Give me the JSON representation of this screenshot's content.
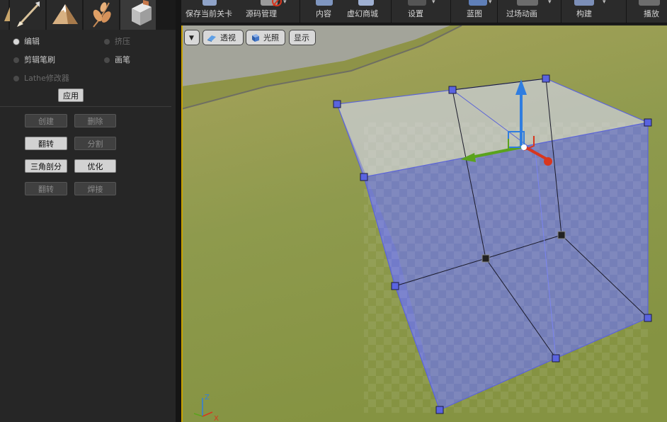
{
  "mode_tabs": [
    {
      "name": "landscape-mode-tab"
    },
    {
      "name": "paint-mode-tab"
    },
    {
      "name": "foliage-mode-tab"
    },
    {
      "name": "geometry-mode-tab"
    }
  ],
  "geometry": {
    "radios": [
      {
        "label": "编辑",
        "selected": true
      },
      {
        "label": "挤压",
        "selected": false
      },
      {
        "label": "剪辑笔刷",
        "selected": false
      },
      {
        "label": "画笔",
        "selected": false
      },
      {
        "label": "Lathe修改器",
        "selected": false
      }
    ],
    "apply_label": "应用",
    "actions": [
      {
        "label": "创建",
        "enabled": false
      },
      {
        "label": "删除",
        "enabled": false
      },
      {
        "label": "翻转",
        "enabled": true
      },
      {
        "label": "分割",
        "enabled": false
      },
      {
        "label": "三角剖分",
        "enabled": true
      },
      {
        "label": "优化",
        "enabled": true
      },
      {
        "label": "翻转",
        "enabled": false
      },
      {
        "label": "焊接",
        "enabled": false
      }
    ]
  },
  "toolbar": {
    "save_current": "保存当前关卡",
    "source_control": "源码管理",
    "content": "内容",
    "marketplace": "虚幻商城",
    "settings": "设置",
    "blueprints": "蓝图",
    "cinematics": "过场动画",
    "build": "构建",
    "play": "播放"
  },
  "viewport": {
    "perspective_label": "透视",
    "lit_label": "光照",
    "show_label": "显示",
    "axis_labels": {
      "z": "Z",
      "x": "X"
    }
  },
  "colors": {
    "selection_fill": "#6f78d8",
    "axis_x": "#d8361e",
    "axis_y": "#5aa31c",
    "axis_z": "#2f7de0",
    "viewport_border": "#c9a200"
  }
}
